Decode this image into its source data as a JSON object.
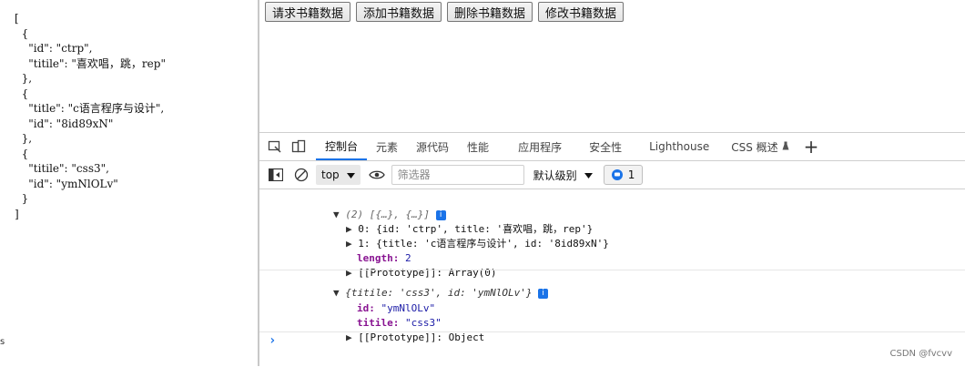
{
  "left_panel": {
    "json_text": "[\n  {\n    \"id\": \"ctrp\",\n    \"titile\": \"喜欢唱，跳，rep\"\n  },\n  {\n    \"title\": \"c语言程序与设计\",\n    \"id\": \"8id89xN\"\n  },\n  {\n    \"titile\": \"css3\",\n    \"id\": \"ymNlOLv\"\n  }\n]",
    "edge_text": "s"
  },
  "buttons": [
    {
      "label": "请求书籍数据"
    },
    {
      "label": "添加书籍数据"
    },
    {
      "label": "删除书籍数据"
    },
    {
      "label": "修改书籍数据"
    }
  ],
  "devtools": {
    "tabs": [
      {
        "label": "控制台"
      },
      {
        "label": "元素"
      },
      {
        "label": "源代码"
      },
      {
        "label": "性能"
      },
      {
        "label": "应用程序"
      },
      {
        "label": "安全性"
      },
      {
        "label": "Lighthouse"
      },
      {
        "label": "CSS 概述"
      }
    ],
    "active_tab": "控制台",
    "add_tab_glyph": "+",
    "toolbar": {
      "context": "top",
      "filter_placeholder": "筛选器",
      "levels_label": "默认级别",
      "issues_count": "1"
    },
    "console": {
      "array_summary": "(2) [{…}, {…}]",
      "item0": "0: {id: 'ctrp', title: '喜欢唱，跳，rep'}",
      "item1": "1: {title: 'c语言程序与设计', id: '8id89xN'}",
      "length_key": "length",
      "length_value": "2",
      "proto_array": "[[Prototype]]: Array(0)",
      "obj_summary": "{titile: 'css3', id: 'ymNlOLv'}",
      "obj_id_key": "id",
      "obj_id_value": "\"ymNlOLv\"",
      "obj_titile_key": "titile",
      "obj_titile_value": "\"css3\"",
      "proto_object": "[[Prototype]]: Object",
      "prompt": "›"
    }
  },
  "watermark": "CSDN @fvcvv",
  "colors": {
    "accent": "#1a73e8",
    "key": "#881391",
    "string": "#1a1aa6"
  }
}
